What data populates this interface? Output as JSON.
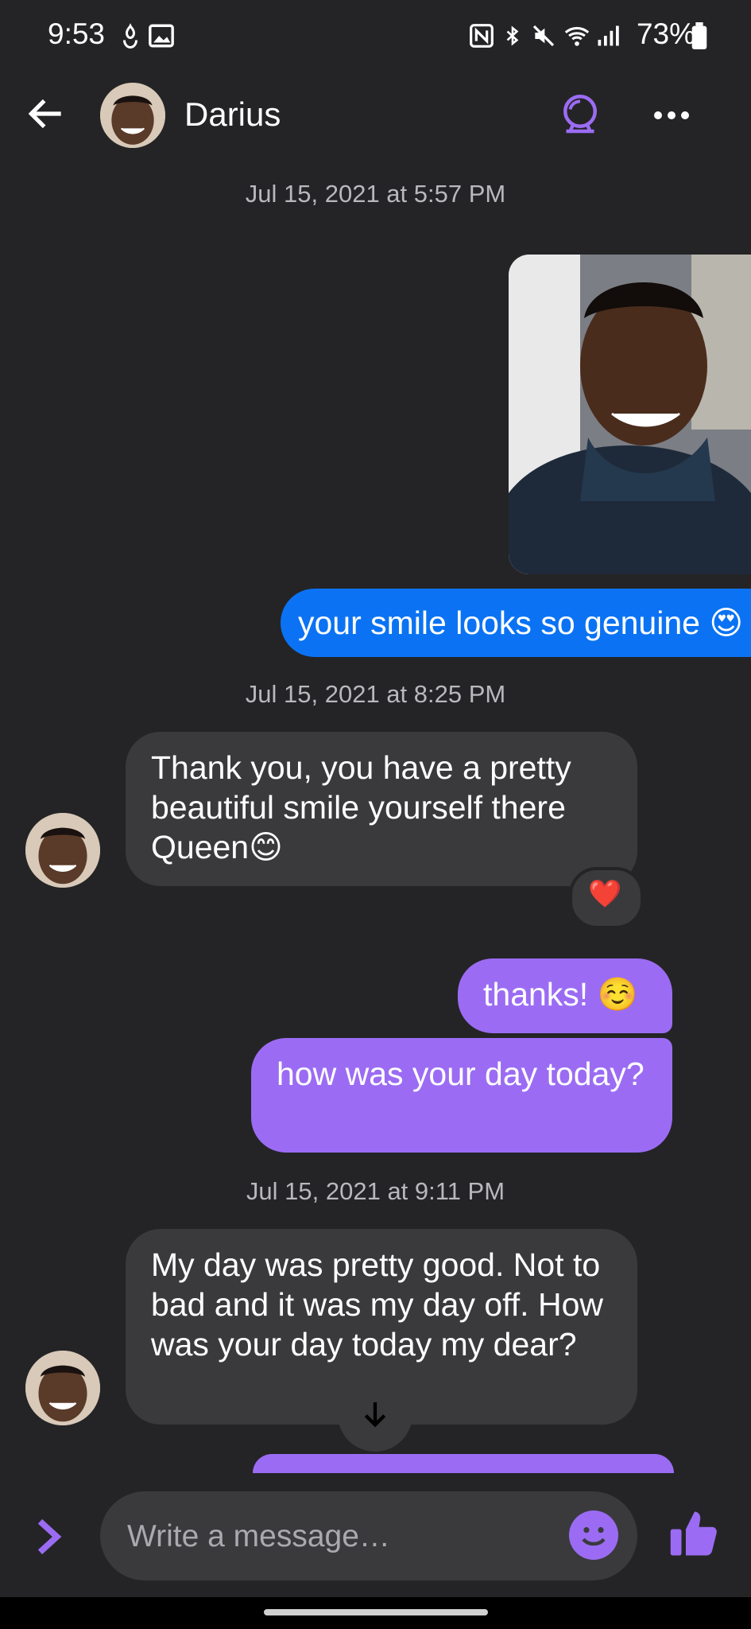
{
  "status_bar": {
    "time": "9:53",
    "battery": "73%",
    "icons": [
      "gesture-icon",
      "gallery-icon",
      "nfc-icon",
      "bluetooth-icon",
      "mute-icon",
      "wifi-icon",
      "signal-icon",
      "battery-icon"
    ]
  },
  "header": {
    "contact_name": "Darius",
    "back_icon": "arrow-left-icon",
    "action_icon": "camera-icon",
    "more_icon": "more-horizontal-icon"
  },
  "colors": {
    "background": "#242426",
    "incoming_bubble": "#3a3a3d",
    "outgoing_blue": "#0b73f3",
    "outgoing_purple": "#9b6cf3",
    "accent": "#9b6cf3"
  },
  "thread": {
    "timestamps": [
      "Jul 15, 2021 at 5:57 PM",
      "Jul 15, 2021 at 8:25 PM",
      "Jul 15, 2021 at 9:11 PM"
    ],
    "messages": [
      {
        "text": "your smile looks so genuine 😍"
      },
      {
        "text": "Thank you, you have a pretty beautiful smile yourself there Queen😊"
      },
      {
        "text": "thanks! ☺️"
      },
      {
        "text": "how was your day today?"
      },
      {
        "text": "My day was pretty good. Not to bad and it was my day off. How was your day today my dear?"
      }
    ],
    "reaction": "❤️"
  },
  "composer": {
    "placeholder": "Write a message…",
    "emoji_icon": "smiley-icon",
    "like_icon": "thumbs-up-icon",
    "expand_icon": "chevron-right-icon"
  }
}
